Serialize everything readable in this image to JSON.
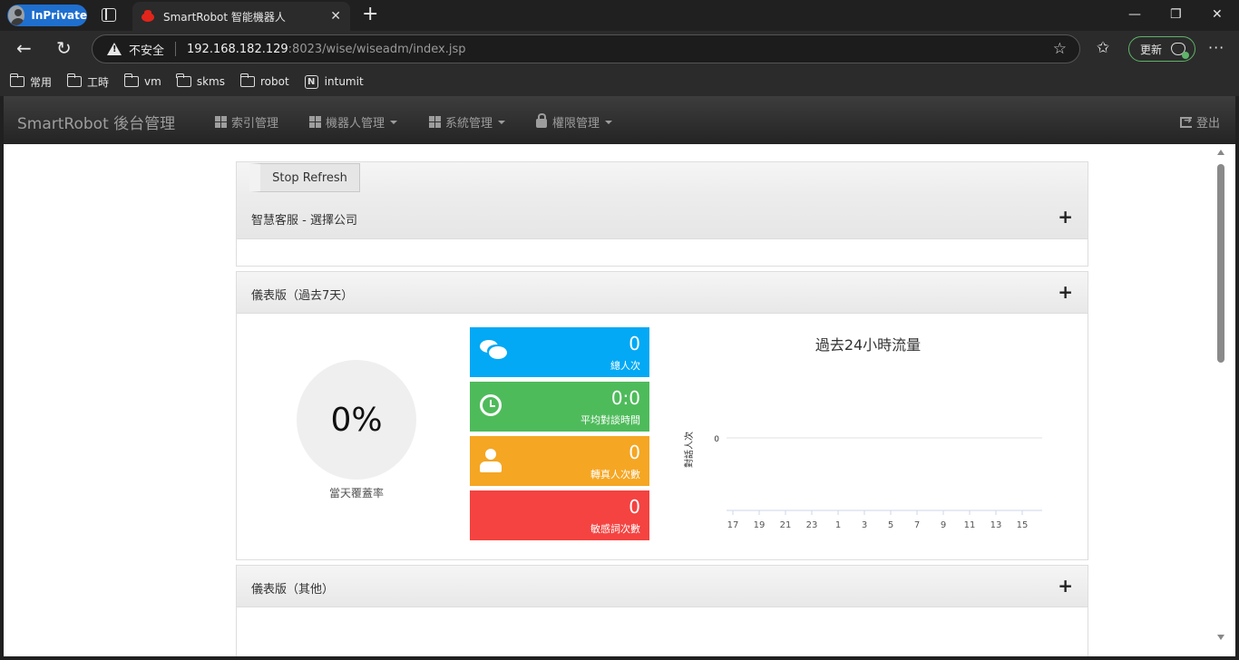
{
  "browser": {
    "profile_label": "InPrivate",
    "tab_title": "SmartRobot 智能機器人",
    "security_label": "不安全",
    "url_host": "192.168.182.129",
    "url_rest": ":8023/wise/wiseadm/index.jsp",
    "update_label": "更新",
    "bookmarks": [
      "常用",
      "工時",
      "vm",
      "skms",
      "robot",
      "intumit"
    ]
  },
  "appnav": {
    "brand": "SmartRobot 後台管理",
    "items": [
      "索引管理",
      "機器人管理",
      "系統管理",
      "權限管理"
    ],
    "logout": "登出"
  },
  "panels": {
    "refresh_button": "Stop Refresh",
    "company_title": "智慧客服 - 選擇公司",
    "dashboard_title": "儀表版（過去7天）",
    "other_title": "儀表版（其他）",
    "expand_symbol": "+"
  },
  "dashboard": {
    "coverage_value": "0%",
    "coverage_label": "當天覆蓋率",
    "tiles": [
      {
        "value": "0",
        "label": "總人次",
        "color": "#03a9f4",
        "icon": "chat-icon"
      },
      {
        "value": "0:0",
        "label": "平均對談時間",
        "color": "#4ebb5b",
        "icon": "clock-icon"
      },
      {
        "value": "0",
        "label": "轉真人次數",
        "color": "#f5a623",
        "icon": "user-icon"
      },
      {
        "value": "0",
        "label": "敏感詞次數",
        "color": "#f44340",
        "icon": "alert-icon"
      }
    ]
  },
  "chart_data": {
    "type": "line",
    "title": "過去24小時流量",
    "ylabel": "對話人次",
    "xlabel": "",
    "categories": [
      "17",
      "19",
      "21",
      "23",
      "1",
      "3",
      "5",
      "7",
      "9",
      "11",
      "13",
      "15"
    ],
    "y_ticks": [
      "0"
    ],
    "series": [
      {
        "values": [
          0,
          0,
          0,
          0,
          0,
          0,
          0,
          0,
          0,
          0,
          0,
          0
        ]
      }
    ],
    "grid": true
  }
}
